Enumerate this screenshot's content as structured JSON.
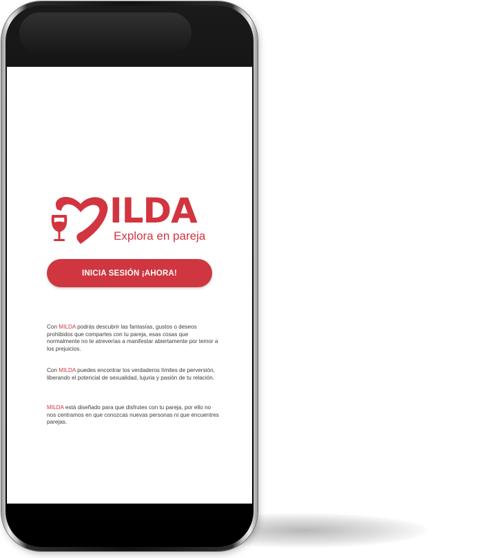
{
  "logo": {
    "wordmark": "ILDA",
    "tagline": "Explora en pareja",
    "icon": "heart-wine-glass-icon",
    "brand_color": "#d2353f"
  },
  "cta": {
    "label": "INICIA SESIÓN ¡AHORA!",
    "color": "#d0363f"
  },
  "paragraphs": [
    {
      "lead": "Con ",
      "brand": "MILDA",
      "rest": " podrás descubrir las fantasías, gustos o deseos prohibidos que compartes con tu pareja, esas cosas que normalmente no te atreverías a manifestar abiertamente por temor a los prejuicios."
    },
    {
      "lead": "Con ",
      "brand": "MILDA",
      "rest": " puedes encontrar los verdaderos límites de perversión, liberando el potencial de sexualidad, lujuria y pasión de tu relación."
    },
    {
      "lead": "",
      "brand": "MILDA",
      "rest": " está diseñado para que disfrutes con tu pareja, por ello no nos centramos en que conozcas nuevas personas ni que encuentres parejas."
    }
  ]
}
